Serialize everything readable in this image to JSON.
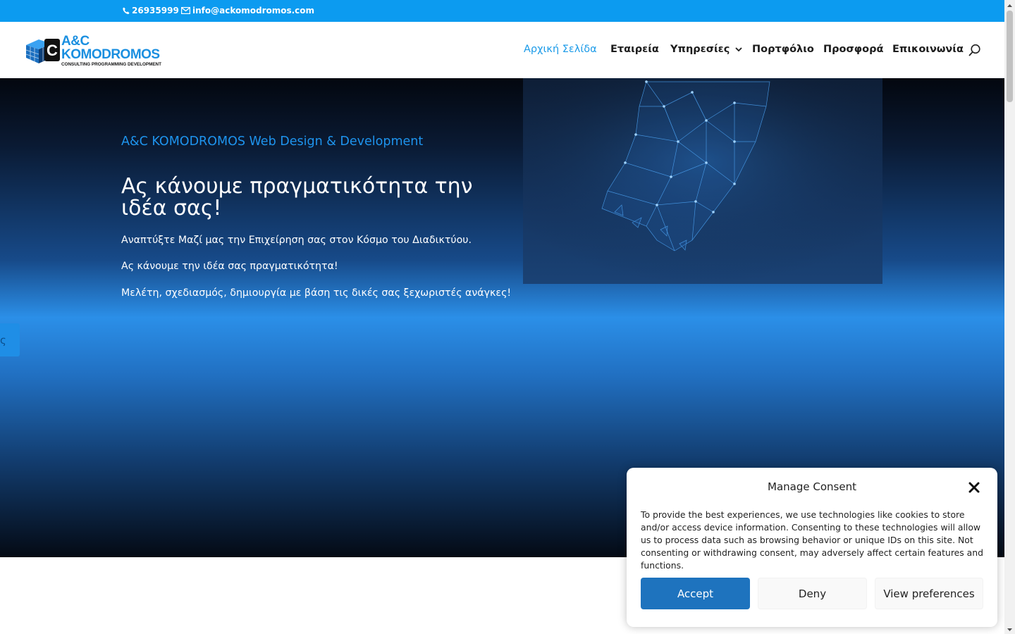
{
  "topbar": {
    "phone": "26935999",
    "email": "info@ackomodromos.com",
    "phone_icon": "phone-icon",
    "email_icon": "envelope-icon"
  },
  "brand": {
    "title": "A&C KOMODROMOS",
    "subtitle": "CONSULTING PROGRAMMING DEVELOPMENT"
  },
  "nav": {
    "items": [
      {
        "label": "Αρχική Σελίδα",
        "active": true
      },
      {
        "label": "Εταιρεία"
      },
      {
        "label": "Υπηρεσίες",
        "has_dropdown": true
      },
      {
        "label": "Πορτφόλιο"
      },
      {
        "label": "Προσφορά"
      },
      {
        "label": "Επικοινωνία"
      }
    ],
    "search_icon": "search-icon"
  },
  "hero": {
    "subtitle": "A&C KOMODROMOS Web Design & Development",
    "title": "Ας κάνουμε πραγματικότητα την ιδέα σας!",
    "paragraphs": [
      "Αναπτύξτε Μαζί μας την Επιχείρηση σας στον Κόσμο του Διαδικτύου.",
      "Ας κάνουμε την ιδέα σας πραγματικότητα!",
      "Μελέτη, σχεδιασμός, δημιουργία με βάση τις δικές σας ξεχωριστές ανάγκες!"
    ],
    "side_tab_text": "ς"
  },
  "consent": {
    "title": "Manage Consent",
    "text": "To provide the best experiences, we use technologies like cookies to store and/or access device information. Consenting to these technologies will allow us to process data such as browsing behavior or unique IDs on this site. Not consenting or withdrawing consent, may adversely affect certain features and functions.",
    "accept": "Accept",
    "deny": "Deny",
    "preferences": "View preferences"
  },
  "colors": {
    "topbar": "#0c9bf0",
    "accent": "#1a9ae8",
    "accept_button": "#1e73be"
  }
}
